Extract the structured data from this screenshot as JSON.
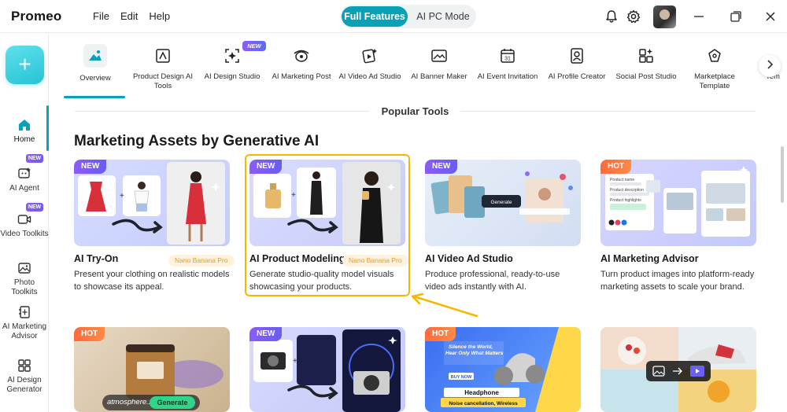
{
  "app": {
    "name": "Promeo",
    "menu": [
      "File",
      "Edit",
      "Help"
    ],
    "modes": {
      "active": "Full Features",
      "inactive": "AI PC Mode"
    }
  },
  "sidebar": {
    "items": [
      {
        "label": "Home",
        "icon": "home-icon",
        "badge": ""
      },
      {
        "label": "AI Agent",
        "icon": "ai-agent-icon",
        "badge": "NEW"
      },
      {
        "label": "Video Toolkits",
        "icon": "video-icon",
        "badge": "NEW"
      },
      {
        "label": "Photo Toolkits",
        "icon": "photo-icon",
        "badge": ""
      },
      {
        "label": "AI Marketing Advisor",
        "icon": "marketing-advisor-icon",
        "badge": ""
      },
      {
        "label": "AI Design Generator",
        "icon": "grid-icon",
        "badge": ""
      }
    ]
  },
  "tools": {
    "items": [
      {
        "label": "Overview",
        "icon": "overview-icon"
      },
      {
        "label": "Product Design AI Tools",
        "icon": "product-design-icon"
      },
      {
        "label": "AI Design Studio",
        "icon": "design-studio-icon",
        "badge": "NEW"
      },
      {
        "label": "AI Marketing Post",
        "icon": "marketing-post-icon"
      },
      {
        "label": "AI Video Ad Studio",
        "icon": "video-ad-icon"
      },
      {
        "label": "AI Banner Maker",
        "icon": "banner-icon"
      },
      {
        "label": "AI Event Invitation",
        "icon": "calendar-icon"
      },
      {
        "label": "AI Profile Creator",
        "icon": "profile-icon"
      },
      {
        "label": "Social Post Studio",
        "icon": "social-post-icon"
      },
      {
        "label": "Marketplace Template",
        "icon": "marketplace-icon"
      }
    ],
    "cut_label": "Tem"
  },
  "main": {
    "section_label": "Popular Tools",
    "heading": "Marketing Assets by Generative AI",
    "cards": [
      {
        "badge": "NEW",
        "title": "AI Try-On",
        "pill": "Nano Banana Pro",
        "desc": "Present your clothing on realistic models to showcase its appeal."
      },
      {
        "badge": "NEW",
        "title": "AI Product Modeling",
        "pill": "Nano Banana Pro",
        "desc": "Generate studio-quality model visuals showcasing your products."
      },
      {
        "badge": "NEW",
        "title": "AI Video Ad Studio",
        "pill": "",
        "desc": "Produce professional, ready-to-use video ads instantly with AI."
      },
      {
        "badge": "HOT",
        "title": "AI Marketing Advisor",
        "pill": "",
        "desc": "Turn product images into platform-ready marketing assets to scale your brand."
      },
      {
        "badge": "HOT",
        "title": "",
        "pill": "",
        "desc": "",
        "overlay_text": "atmosphere...",
        "overlay_button": "Generate"
      },
      {
        "badge": "NEW",
        "title": "",
        "pill": "",
        "desc": ""
      },
      {
        "badge": "HOT",
        "title": "",
        "pill": "",
        "desc": "",
        "ad_lines": [
          "Silence the World,",
          "Hear Only What Matters",
          "BUY NOW",
          "Headphone",
          "Noise cancellation, Wireless"
        ]
      },
      {
        "badge": "",
        "title": "",
        "pill": "",
        "desc": ""
      }
    ],
    "card4_mock": {
      "line1": "Product name",
      "line2": "Product description",
      "line3": "Product highlights"
    },
    "video_mock_button": "Generate"
  },
  "colors": {
    "accent": "#0aa1b6",
    "highlight": "#f5b800",
    "new_badge": "#8b5cf6",
    "hot_badge": "#ff6a3d"
  }
}
